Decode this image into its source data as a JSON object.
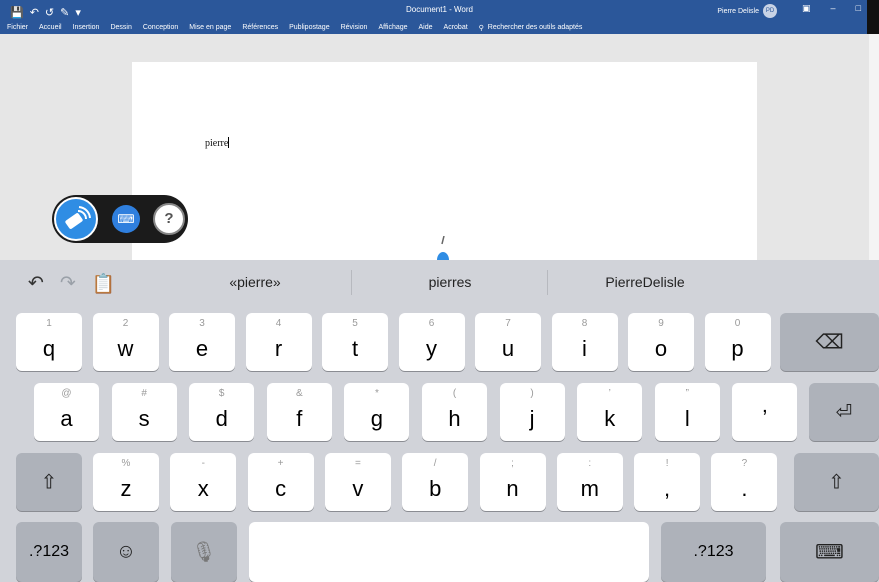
{
  "word": {
    "doc_title": "Document1 - Word",
    "user_name": "Pierre Delisle",
    "avatar_initials": "PD",
    "tabs": [
      "Fichier",
      "Accueil",
      "Insertion",
      "Dessin",
      "Conception",
      "Mise en page",
      "Références",
      "Publipostage",
      "Révision",
      "Affichage",
      "Aide",
      "Acrobat"
    ],
    "tell_me": "Rechercher des outils adaptés"
  },
  "document": {
    "text": "pierre"
  },
  "suggestions": [
    "«pierre»",
    "pierres",
    "PierreDelisle"
  ],
  "keyboard": {
    "row1": [
      {
        "alt": "1",
        "main": "q"
      },
      {
        "alt": "2",
        "main": "w"
      },
      {
        "alt": "3",
        "main": "e"
      },
      {
        "alt": "4",
        "main": "r"
      },
      {
        "alt": "5",
        "main": "t"
      },
      {
        "alt": "6",
        "main": "y"
      },
      {
        "alt": "7",
        "main": "u"
      },
      {
        "alt": "8",
        "main": "i"
      },
      {
        "alt": "9",
        "main": "o"
      },
      {
        "alt": "0",
        "main": "p"
      }
    ],
    "row2": [
      {
        "alt": "@",
        "main": "a"
      },
      {
        "alt": "#",
        "main": "s"
      },
      {
        "alt": "$",
        "main": "d"
      },
      {
        "alt": "&",
        "main": "f"
      },
      {
        "alt": "*",
        "main": "g"
      },
      {
        "alt": "(",
        "main": "h"
      },
      {
        "alt": ")",
        "main": "j"
      },
      {
        "alt": "’",
        "main": "k"
      },
      {
        "alt": "”",
        "main": "l"
      },
      {
        "alt": "",
        "main": "ʼ"
      }
    ],
    "row3": [
      {
        "alt": "%",
        "main": "z"
      },
      {
        "alt": "-",
        "main": "x"
      },
      {
        "alt": "+",
        "main": "c"
      },
      {
        "alt": "=",
        "main": "v"
      },
      {
        "alt": "/",
        "main": "b"
      },
      {
        "alt": ";",
        "main": "n"
      },
      {
        "alt": ":",
        "main": "m"
      },
      {
        "alt": "!",
        "main": ","
      },
      {
        "alt": "?",
        "main": "."
      }
    ],
    "numbers_label": ".?123"
  },
  "icons": {
    "undo": "undo-icon",
    "redo": "redo-icon",
    "paste": "clipboard-icon",
    "backspace": "backspace-icon",
    "return": "return-icon",
    "shift": "shift-icon",
    "emoji": "emoji-icon",
    "mic": "microphone-icon",
    "dismiss": "keyboard-dismiss-icon"
  },
  "colors": {
    "word_blue": "#2b579a",
    "accent_blue": "#2f8de4",
    "keyboard_bg": "#d1d3d9"
  }
}
